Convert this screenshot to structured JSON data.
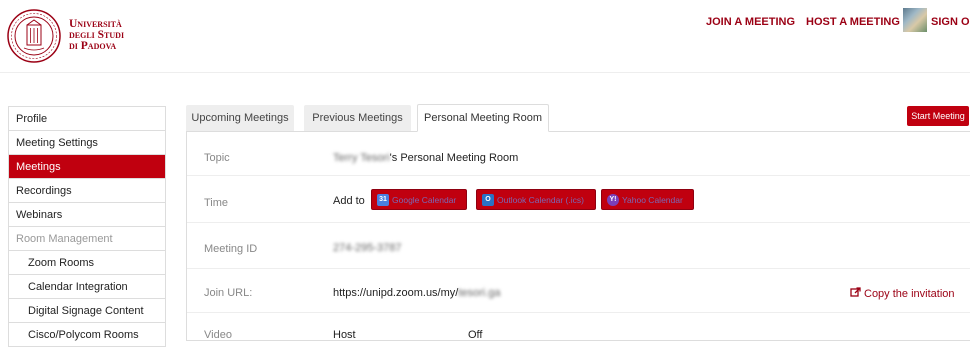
{
  "header": {
    "university": [
      "Università",
      "degli Studi",
      "di Padova"
    ],
    "nav": {
      "join": "JOIN A MEETING",
      "host": "HOST A MEETING",
      "sign_out": "SIGN OUT"
    }
  },
  "sidebar": {
    "items": [
      {
        "label": "Profile"
      },
      {
        "label": "Meeting Settings"
      },
      {
        "label": "Meetings",
        "active": true
      },
      {
        "label": "Recordings"
      },
      {
        "label": "Webinars"
      },
      {
        "label": "Room Management",
        "muted": true
      },
      {
        "label": "Zoom Rooms"
      },
      {
        "label": "Calendar Integration"
      },
      {
        "label": "Digital Signage Content"
      },
      {
        "label": "Cisco/Polycom Rooms"
      }
    ]
  },
  "tabs": [
    "Upcoming Meetings",
    "Previous Meetings",
    "Personal Meeting Room"
  ],
  "start_meeting": "Start Meeting",
  "details": {
    "topic_label": "Topic",
    "topic_name_blurred": "Terry Tesori",
    "topic_suffix": "'s Personal Meeting Room",
    "time_label": "Time",
    "add_to": "Add to",
    "calendars": {
      "google": "Google Calendar",
      "outlook": "Outlook Calendar (.ics)",
      "yahoo": "Yahoo Calendar"
    },
    "meeting_id_label": "Meeting ID",
    "meeting_id_blurred": "274-295-3787",
    "join_url_label": "Join URL:",
    "join_url_prefix": "https://unipd.zoom.us/my/",
    "join_url_blurred": "tesori.ga",
    "copy_invitation": "Copy the invitation",
    "video_label": "Video",
    "video_host": "Host",
    "video_host_value": "Off"
  },
  "colors": {
    "brand_red": "#c0000f",
    "text_red": "#9b0014"
  }
}
